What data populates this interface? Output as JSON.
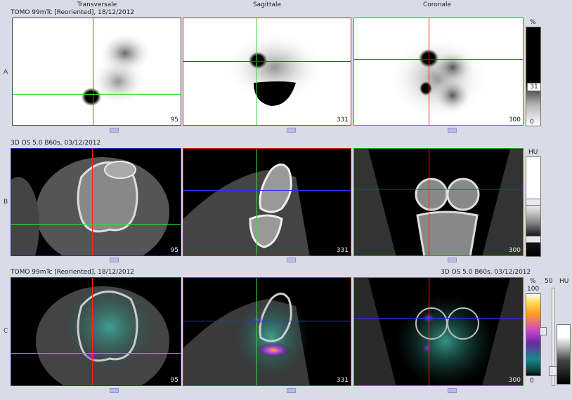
{
  "headers": {
    "transversale": "Transversale",
    "sagittale": "Sagittale",
    "coronale": "Coronale"
  },
  "rows": {
    "a": {
      "label": "A",
      "title": "TOMO 99mTc [Reoriented], 18/12/2012"
    },
    "b": {
      "label": "B",
      "title": "3D OS 5.0 B60s, 03/12/2012"
    },
    "c": {
      "label": "C",
      "title_left": "TOMO 99mTc [Reoriented], 18/12/2012",
      "title_right": "3D OS 5.0 B60s, 03/12/2012"
    }
  },
  "slices": {
    "transversale": "95",
    "sagittale": "331",
    "coronale": "300"
  },
  "scales": {
    "a": {
      "unit": "%",
      "mid": "31",
      "min": "0"
    },
    "b": {
      "unit": "HU"
    },
    "c": {
      "unit_left": "%",
      "unit_mid": "50",
      "unit_right": "HU",
      "max": "100",
      "min": "0"
    }
  },
  "colors": {
    "transversale_frame": "#2233aa",
    "sagittale_frame": "#cc2222",
    "coronale_frame": "#22aa22",
    "crosshair_red": "#ff2222",
    "crosshair_green": "#33dd33",
    "crosshair_blue": "#2233ff"
  }
}
